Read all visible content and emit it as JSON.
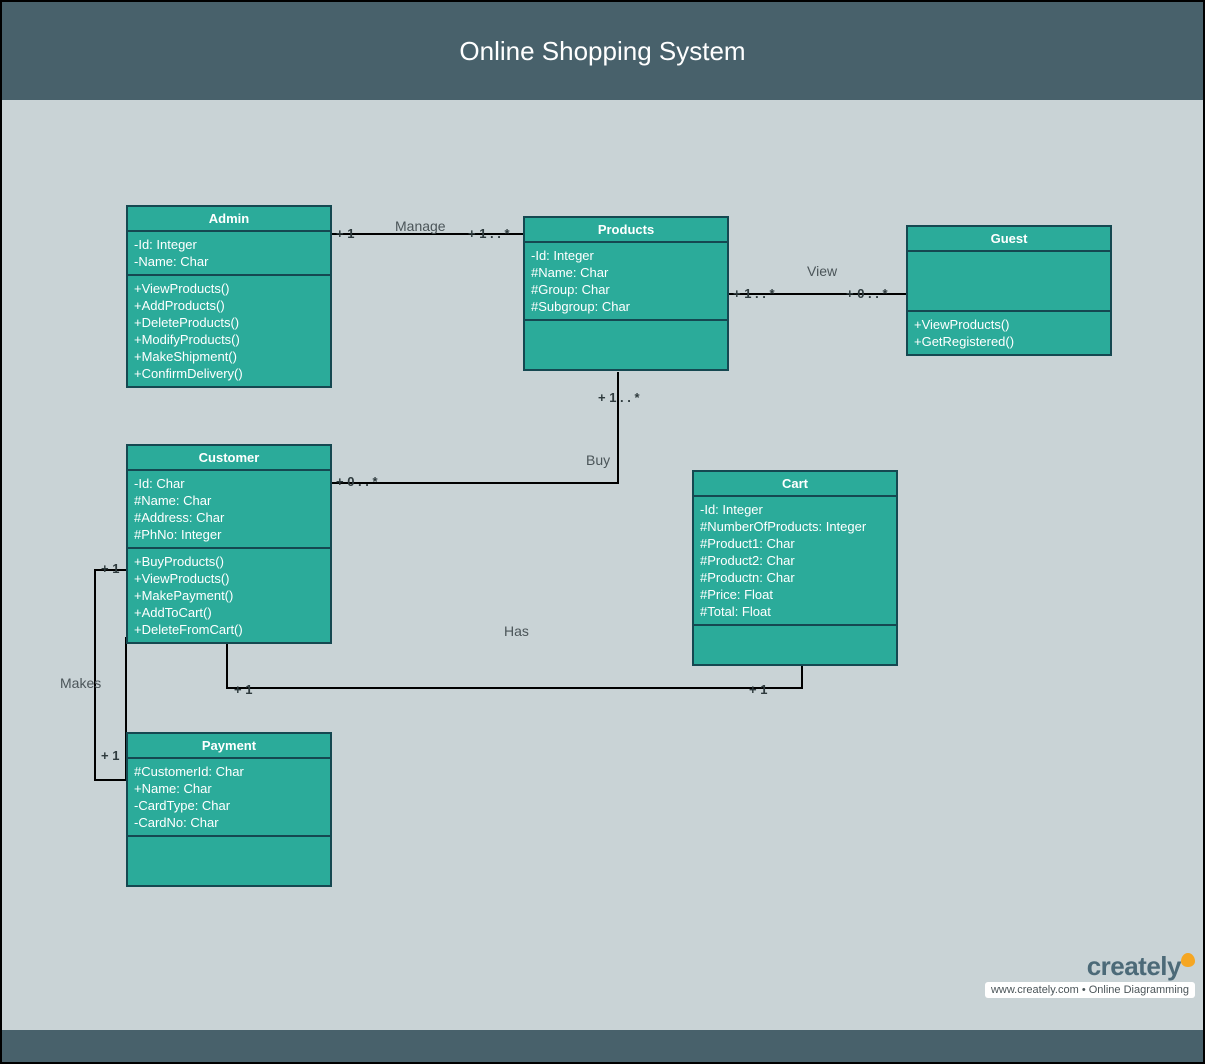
{
  "title": "Online Shopping System",
  "footer": {
    "brand": "creately",
    "tagline": "www.creately.com • Online Diagramming"
  },
  "classes": {
    "admin": {
      "name": "Admin",
      "attributes": [
        "-Id: Integer",
        "-Name: Char"
      ],
      "methods": [
        "+ViewProducts()",
        "+AddProducts()",
        "+DeleteProducts()",
        "+ModifyProducts()",
        "+MakeShipment()",
        "+ConfirmDelivery()"
      ]
    },
    "products": {
      "name": "Products",
      "attributes": [
        "-Id: Integer",
        "#Name: Char",
        "#Group: Char",
        "#Subgroup: Char"
      ],
      "methods": []
    },
    "guest": {
      "name": "Guest",
      "attributes": [],
      "methods": [
        "+ViewProducts()",
        "+GetRegistered()"
      ]
    },
    "customer": {
      "name": "Customer",
      "attributes": [
        "-Id: Char",
        "#Name: Char",
        "#Address: Char",
        "#PhNo: Integer"
      ],
      "methods": [
        "+BuyProducts()",
        "+ViewProducts()",
        "+MakePayment()",
        "+AddToCart()",
        "+DeleteFromCart()"
      ]
    },
    "cart": {
      "name": "Cart",
      "attributes": [
        "-Id: Integer",
        "#NumberOfProducts: Integer",
        "#Product1: Char",
        "#Product2: Char",
        "#Productn: Char",
        "#Price: Float",
        "#Total: Float"
      ],
      "methods": []
    },
    "payment": {
      "name": "Payment",
      "attributes": [
        "#CustomerId: Char",
        "+Name: Char",
        "-CardType: Char",
        "-CardNo: Char"
      ],
      "methods": []
    }
  },
  "relationships": {
    "manage": {
      "label": "Manage",
      "mult_left": "+ 1",
      "mult_right": "+ 1 . . *"
    },
    "view": {
      "label": "View",
      "mult_left": "+ 1 . . *",
      "mult_right": "+ 0 . . *"
    },
    "buy": {
      "label": "Buy",
      "mult_products": "+ 1 . . *",
      "mult_customer": "+ 0 . . *"
    },
    "has": {
      "label": "Has",
      "mult_customer": "+ 1",
      "mult_cart": "+ 1"
    },
    "makes": {
      "label": "Makes",
      "mult_customer": "+ 1",
      "mult_payment": "+ 1"
    }
  }
}
